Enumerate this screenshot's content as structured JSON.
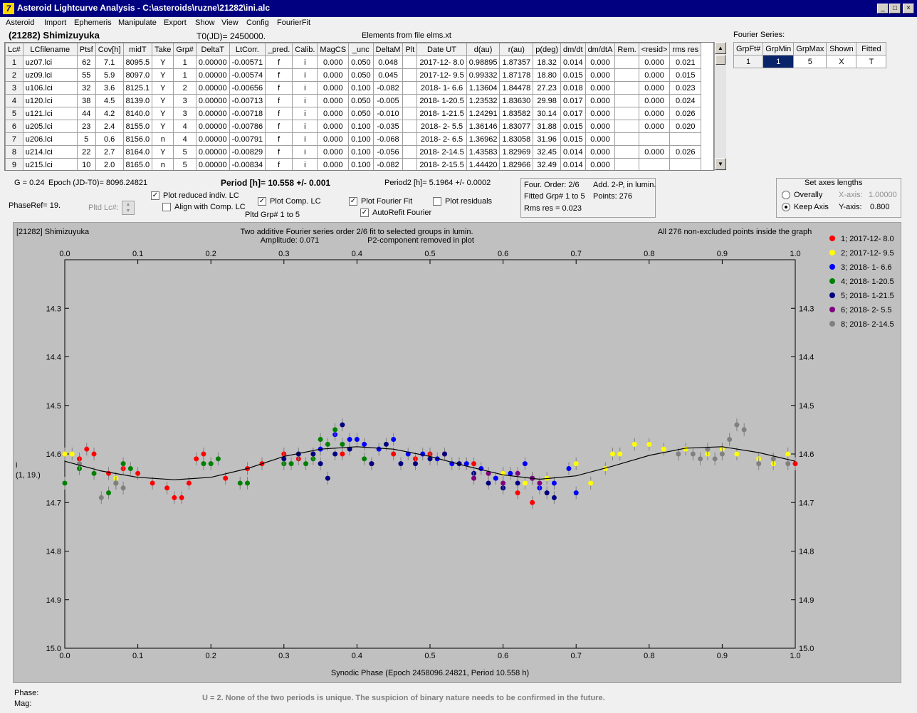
{
  "window": {
    "title": "Asteroid Lightcurve Analysis - C:\\asteroids\\ruzne\\21282\\ini.alc",
    "icon": "app-icon",
    "icon_glyph": "7"
  },
  "menu": [
    "Asteroid",
    "Import",
    "Ephemeris",
    "Manipulate",
    "Export",
    "Show",
    "View",
    "Config",
    "FourierFit"
  ],
  "header": {
    "asteroid": "(21282) Shimizuyuka",
    "t0": "T0(JD)= 2450000.",
    "elements": "Elements from file elms.xt"
  },
  "table": {
    "columns": [
      "Lc#",
      "LCfilename",
      "Ptsf",
      "Cov[h]",
      "midT",
      "Take",
      "Grp#",
      "DeltaT",
      "LtCorr.",
      "_pred.",
      "Calib.",
      "MagCS",
      "_unc",
      "DeltaM",
      "Plt",
      "Date UT",
      "d(au)",
      "r(au)",
      "p(deg)",
      "dm/dt",
      "dm/dtA",
      "Rem.",
      "<resid>",
      "rms res"
    ],
    "rows": [
      [
        "1",
        "uz07.lci",
        "62",
        "7.1",
        "8095.5",
        "Y",
        "1",
        "0.00000",
        "-0.00571",
        "f",
        "i",
        "0.000",
        "0.050",
        "0.048",
        "",
        "2017-12- 8.0",
        "0.98895",
        "1.87357",
        "18.32",
        "0.014",
        "0.000",
        "",
        "0.000",
        "0.021"
      ],
      [
        "2",
        "uz09.lci",
        "55",
        "5.9",
        "8097.0",
        "Y",
        "1",
        "0.00000",
        "-0.00574",
        "f",
        "i",
        "0.000",
        "0.050",
        "0.045",
        "",
        "2017-12- 9.5",
        "0.99332",
        "1.87178",
        "18.80",
        "0.015",
        "0.000",
        "",
        "0.000",
        "0.015"
      ],
      [
        "3",
        "u106.lci",
        "32",
        "3.6",
        "8125.1",
        "Y",
        "2",
        "0.00000",
        "-0.00656",
        "f",
        "i",
        "0.000",
        "0.100",
        "-0.082",
        "",
        "2018- 1- 6.6",
        "1.13604",
        "1.84478",
        "27.23",
        "0.018",
        "0.000",
        "",
        "0.000",
        "0.023"
      ],
      [
        "4",
        "u120.lci",
        "38",
        "4.5",
        "8139.0",
        "Y",
        "3",
        "0.00000",
        "-0.00713",
        "f",
        "i",
        "0.000",
        "0.050",
        "-0.005",
        "",
        "2018- 1-20.5",
        "1.23532",
        "1.83630",
        "29.98",
        "0.017",
        "0.000",
        "",
        "0.000",
        "0.024"
      ],
      [
        "5",
        "u121.lci",
        "44",
        "4.2",
        "8140.0",
        "Y",
        "3",
        "0.00000",
        "-0.00718",
        "f",
        "i",
        "0.000",
        "0.050",
        "-0.010",
        "",
        "2018- 1-21.5",
        "1.24291",
        "1.83582",
        "30.14",
        "0.017",
        "0.000",
        "",
        "0.000",
        "0.026"
      ],
      [
        "6",
        "u205.lci",
        "23",
        "2.4",
        "8155.0",
        "Y",
        "4",
        "0.00000",
        "-0.00786",
        "f",
        "i",
        "0.000",
        "0.100",
        "-0.035",
        "",
        "2018- 2- 5.5",
        "1.36146",
        "1.83077",
        "31.88",
        "0.015",
        "0.000",
        "",
        "0.000",
        "0.020"
      ],
      [
        "7",
        "u206.lci",
        "5",
        "0.6",
        "8156.0",
        "n",
        "4",
        "0.00000",
        "-0.00791",
        "f",
        "i",
        "0.000",
        "0.100",
        "-0.068",
        "",
        "2018- 2- 6.5",
        "1.36962",
        "1.83058",
        "31.96",
        "0.015",
        "0.000",
        "",
        "",
        ""
      ],
      [
        "8",
        "u214.lci",
        "22",
        "2.7",
        "8164.0",
        "Y",
        "5",
        "0.00000",
        "-0.00829",
        "f",
        "i",
        "0.000",
        "0.100",
        "-0.056",
        "",
        "2018- 2-14.5",
        "1.43583",
        "1.82969",
        "32.45",
        "0.014",
        "0.000",
        "",
        "0.000",
        "0.026"
      ],
      [
        "9",
        "u215.lci",
        "10",
        "2.0",
        "8165.0",
        "n",
        "5",
        "0.00000",
        "-0.00834",
        "f",
        "i",
        "0.000",
        "0.100",
        "-0.082",
        "",
        "2018- 2-15.5",
        "1.44420",
        "1.82966",
        "32.49",
        "0.014",
        "0.000",
        "",
        "",
        ""
      ]
    ]
  },
  "fourier_series": {
    "label": "Fourier Series:",
    "columns": [
      "GrpFt#",
      "GrpMin",
      "GrpMax",
      "Shown",
      "Fitted"
    ],
    "row": [
      "1",
      "1",
      "5",
      "X",
      "T"
    ]
  },
  "info": {
    "g": "G = 0.24",
    "epoch": "Epoch (JD-T0)= 8096.24821",
    "period": "Period [h]= 10.558 +/- 0.001",
    "period2": "Period2 [h]= 5.1964 +/- 0.0002",
    "phaseref": "PhaseRef= 19.",
    "pltd_lc": "Pltd Lc#:",
    "pltd_grp": "Pltd Grp#  1   to   5"
  },
  "checkboxes": {
    "plot_reduced": {
      "label": "Plot reduced indiv. LC",
      "checked": true
    },
    "align_comp": {
      "label": "Align with Comp. LC",
      "checked": false
    },
    "plot_comp": {
      "label": "Plot Comp. LC",
      "checked": true
    },
    "plot_fourier": {
      "label": "Plot Fourier Fit",
      "checked": true
    },
    "autorefit": {
      "label": "AutoRefit Fourier",
      "checked": true
    },
    "plot_residuals": {
      "label": "Plot residuals",
      "checked": false
    }
  },
  "fit_box": {
    "order": "Four. Order:  2/6",
    "add": "Add. 2-P, in lumin.",
    "fitted": "Fitted Grp# 1 to 5",
    "points": "Points: 276",
    "rms": "Rms res      = 0.023"
  },
  "axes_box": {
    "title": "Set axes lengths",
    "overally": "Overally",
    "keep_axis": "Keep Axis",
    "xaxis_label": "X-axis:",
    "xaxis_value": "1.00000",
    "yaxis_label": "Y-axis:",
    "yaxis_value": "0.800",
    "selected": "Keep Axis"
  },
  "plot": {
    "name": "[21282] Shimizuyuka",
    "title_line1": "Two additive Fourier series order 2/6 fit to selected groups in lumin.",
    "title_line2_amp": "Amplitude: 0.071",
    "title_line2_p2": "P2-component removed in plot",
    "points_note": "All 276 non-excluded points inside the graph",
    "ylabel_line1": "i",
    "ylabel_line2": "(1, 19.)",
    "xlabel": "Synodic Phase (Epoch 2458096.24821, Period 10.558 h)"
  },
  "footer": {
    "phase": "Phase:",
    "mag": "Mag:",
    "note": "U = 2.  None of the two periods is unique.  The suspicion of binary nature needs to be confirmed in the future."
  },
  "chart_data": {
    "type": "scatter",
    "xlim": [
      0.0,
      1.0
    ],
    "ylim": [
      15.0,
      14.2
    ],
    "xticks": [
      "0.0",
      "0.1",
      "0.2",
      "0.3",
      "0.4",
      "0.5",
      "0.6",
      "0.7",
      "0.8",
      "0.9",
      "1.0"
    ],
    "yticks": [
      "14.3",
      "14.4",
      "14.5",
      "14.6",
      "14.7",
      "14.8",
      "14.9",
      "15.0"
    ],
    "fit_curve": [
      [
        0.0,
        14.615
      ],
      [
        0.05,
        14.635
      ],
      [
        0.1,
        14.648
      ],
      [
        0.15,
        14.653
      ],
      [
        0.2,
        14.648
      ],
      [
        0.25,
        14.63
      ],
      [
        0.3,
        14.605
      ],
      [
        0.35,
        14.59
      ],
      [
        0.4,
        14.585
      ],
      [
        0.45,
        14.59
      ],
      [
        0.5,
        14.605
      ],
      [
        0.55,
        14.625
      ],
      [
        0.6,
        14.643
      ],
      [
        0.65,
        14.652
      ],
      [
        0.7,
        14.645
      ],
      [
        0.75,
        14.625
      ],
      [
        0.8,
        14.603
      ],
      [
        0.85,
        14.588
      ],
      [
        0.9,
        14.585
      ],
      [
        0.95,
        14.597
      ],
      [
        1.0,
        14.615
      ]
    ],
    "series": [
      {
        "name": "1; 2017-12- 8.0",
        "color": "#ff0000",
        "points": [
          [
            0.0,
            14.6
          ],
          [
            0.02,
            14.61
          ],
          [
            0.03,
            14.59
          ],
          [
            0.04,
            14.6
          ],
          [
            0.06,
            14.64
          ],
          [
            0.08,
            14.63
          ],
          [
            0.1,
            14.64
          ],
          [
            0.12,
            14.66
          ],
          [
            0.14,
            14.67
          ],
          [
            0.15,
            14.69
          ],
          [
            0.16,
            14.69
          ],
          [
            0.17,
            14.66
          ],
          [
            0.18,
            14.61
          ],
          [
            0.19,
            14.6
          ],
          [
            0.22,
            14.65
          ],
          [
            0.25,
            14.63
          ],
          [
            0.27,
            14.62
          ],
          [
            0.3,
            14.6
          ],
          [
            0.32,
            14.61
          ],
          [
            0.34,
            14.6
          ],
          [
            0.38,
            14.6
          ],
          [
            0.42,
            14.62
          ],
          [
            0.45,
            14.6
          ],
          [
            0.48,
            14.61
          ],
          [
            0.5,
            14.6
          ],
          [
            0.52,
            14.6
          ],
          [
            0.56,
            14.62
          ],
          [
            0.6,
            14.64
          ],
          [
            0.62,
            14.68
          ],
          [
            0.64,
            14.7
          ],
          [
            1.0,
            14.62
          ]
        ]
      },
      {
        "name": "2; 2017-12- 9.5",
        "color": "#ffff00",
        "points": [
          [
            0.0,
            14.6
          ],
          [
            0.01,
            14.6
          ],
          [
            0.07,
            14.65
          ],
          [
            0.55,
            14.62
          ],
          [
            0.6,
            14.64
          ],
          [
            0.63,
            14.66
          ],
          [
            0.66,
            14.65
          ],
          [
            0.7,
            14.62
          ],
          [
            0.72,
            14.66
          ],
          [
            0.74,
            14.63
          ],
          [
            0.75,
            14.6
          ],
          [
            0.76,
            14.6
          ],
          [
            0.78,
            14.58
          ],
          [
            0.8,
            14.58
          ],
          [
            0.82,
            14.59
          ],
          [
            0.85,
            14.59
          ],
          [
            0.88,
            14.6
          ],
          [
            0.9,
            14.59
          ],
          [
            0.92,
            14.6
          ],
          [
            0.95,
            14.61
          ],
          [
            0.97,
            14.62
          ],
          [
            0.99,
            14.6
          ]
        ]
      },
      {
        "name": "3; 2018- 1- 6.6",
        "color": "#0000ff",
        "points": [
          [
            0.35,
            14.59
          ],
          [
            0.37,
            14.56
          ],
          [
            0.39,
            14.57
          ],
          [
            0.4,
            14.57
          ],
          [
            0.41,
            14.58
          ],
          [
            0.43,
            14.59
          ],
          [
            0.45,
            14.57
          ],
          [
            0.47,
            14.6
          ],
          [
            0.49,
            14.6
          ],
          [
            0.51,
            14.61
          ],
          [
            0.53,
            14.62
          ],
          [
            0.55,
            14.62
          ],
          [
            0.57,
            14.63
          ],
          [
            0.59,
            14.65
          ],
          [
            0.61,
            14.64
          ],
          [
            0.63,
            14.62
          ],
          [
            0.65,
            14.67
          ],
          [
            0.67,
            14.66
          ],
          [
            0.69,
            14.63
          ],
          [
            0.7,
            14.68
          ]
        ]
      },
      {
        "name": "4; 2018- 1-20.5",
        "color": "#008000",
        "points": [
          [
            0.0,
            14.66
          ],
          [
            0.02,
            14.63
          ],
          [
            0.04,
            14.64
          ],
          [
            0.06,
            14.68
          ],
          [
            0.07,
            14.66
          ],
          [
            0.08,
            14.62
          ],
          [
            0.09,
            14.63
          ],
          [
            0.19,
            14.62
          ],
          [
            0.2,
            14.62
          ],
          [
            0.21,
            14.61
          ],
          [
            0.24,
            14.66
          ],
          [
            0.25,
            14.66
          ],
          [
            0.3,
            14.62
          ],
          [
            0.31,
            14.62
          ],
          [
            0.33,
            14.62
          ],
          [
            0.34,
            14.61
          ],
          [
            0.35,
            14.57
          ],
          [
            0.36,
            14.58
          ],
          [
            0.37,
            14.55
          ],
          [
            0.38,
            14.58
          ],
          [
            0.41,
            14.61
          ]
        ]
      },
      {
        "name": "5; 2018- 1-21.5",
        "color": "#000080",
        "points": [
          [
            0.3,
            14.61
          ],
          [
            0.32,
            14.6
          ],
          [
            0.34,
            14.6
          ],
          [
            0.35,
            14.62
          ],
          [
            0.36,
            14.65
          ],
          [
            0.37,
            14.6
          ],
          [
            0.38,
            14.54
          ],
          [
            0.39,
            14.59
          ],
          [
            0.42,
            14.62
          ],
          [
            0.44,
            14.58
          ],
          [
            0.46,
            14.62
          ],
          [
            0.48,
            14.62
          ],
          [
            0.5,
            14.61
          ],
          [
            0.52,
            14.6
          ],
          [
            0.54,
            14.62
          ],
          [
            0.56,
            14.64
          ],
          [
            0.58,
            14.66
          ],
          [
            0.6,
            14.67
          ],
          [
            0.62,
            14.66
          ],
          [
            0.64,
            14.65
          ],
          [
            0.66,
            14.68
          ],
          [
            0.67,
            14.69
          ]
        ]
      },
      {
        "name": "6; 2018- 2- 5.5",
        "color": "#800080",
        "points": [
          [
            0.56,
            14.65
          ],
          [
            0.58,
            14.64
          ],
          [
            0.6,
            14.66
          ],
          [
            0.62,
            14.64
          ],
          [
            0.64,
            14.65
          ],
          [
            0.65,
            14.66
          ]
        ]
      },
      {
        "name": "8; 2018- 2-14.5",
        "color": "#808080",
        "points": [
          [
            0.02,
            14.62
          ],
          [
            0.05,
            14.69
          ],
          [
            0.07,
            14.66
          ],
          [
            0.08,
            14.67
          ],
          [
            0.84,
            14.6
          ],
          [
            0.86,
            14.6
          ],
          [
            0.87,
            14.61
          ],
          [
            0.88,
            14.59
          ],
          [
            0.89,
            14.61
          ],
          [
            0.9,
            14.6
          ],
          [
            0.91,
            14.57
          ],
          [
            0.92,
            14.54
          ],
          [
            0.93,
            14.55
          ],
          [
            0.95,
            14.62
          ],
          [
            0.97,
            14.61
          ],
          [
            0.99,
            14.62
          ]
        ]
      }
    ]
  }
}
